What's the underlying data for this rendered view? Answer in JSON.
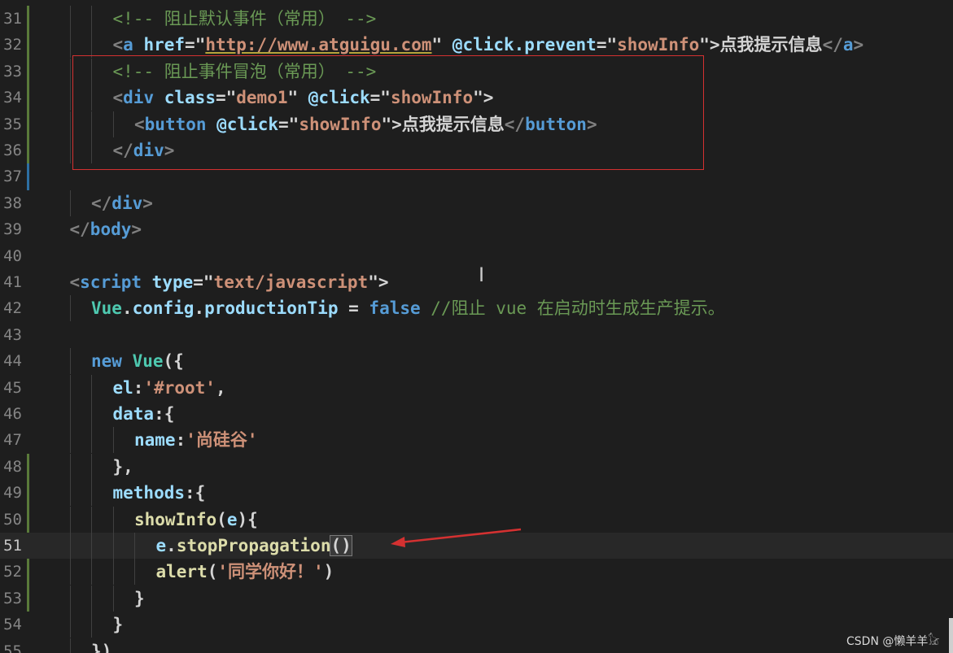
{
  "editor": {
    "lines": [
      {
        "n": "31",
        "indent": 3,
        "tokens": [
          {
            "t": "<!-- 阻止默认事件（常用） -->",
            "c": "cm"
          }
        ]
      },
      {
        "n": "32",
        "indent": 3,
        "tokens": [
          {
            "t": "<",
            "c": "br"
          },
          {
            "t": "a",
            "c": "tag"
          },
          {
            "t": " ",
            "c": "tx"
          },
          {
            "t": "href",
            "c": "at"
          },
          {
            "t": "=\"",
            "c": "tx"
          },
          {
            "t": "http://www.atguigu.com",
            "c": "st link"
          },
          {
            "t": "\"",
            "c": "tx"
          },
          {
            "t": " @click.prevent",
            "c": "at"
          },
          {
            "t": "=\"",
            "c": "tx"
          },
          {
            "t": "showInfo",
            "c": "st"
          },
          {
            "t": "\">",
            "c": "tx"
          },
          {
            "t": "点我提示信息",
            "c": "tx"
          },
          {
            "t": "</",
            "c": "br"
          },
          {
            "t": "a",
            "c": "tag"
          },
          {
            "t": ">",
            "c": "br"
          }
        ]
      },
      {
        "n": "33",
        "indent": 3,
        "tokens": [
          {
            "t": "<!-- 阻止事件冒泡（常用） -->",
            "c": "cm"
          }
        ]
      },
      {
        "n": "34",
        "indent": 3,
        "tokens": [
          {
            "t": "<",
            "c": "br"
          },
          {
            "t": "div",
            "c": "tag"
          },
          {
            "t": " ",
            "c": "tx"
          },
          {
            "t": "class",
            "c": "at"
          },
          {
            "t": "=\"",
            "c": "tx"
          },
          {
            "t": "demo1",
            "c": "st"
          },
          {
            "t": "\"",
            "c": "tx"
          },
          {
            "t": " @click",
            "c": "at"
          },
          {
            "t": "=\"",
            "c": "tx"
          },
          {
            "t": "showInfo",
            "c": "st"
          },
          {
            "t": "\">",
            "c": "tx"
          }
        ]
      },
      {
        "n": "35",
        "indent": 4,
        "tokens": [
          {
            "t": "<",
            "c": "br"
          },
          {
            "t": "button",
            "c": "tag"
          },
          {
            "t": " @click",
            "c": "at"
          },
          {
            "t": "=\"",
            "c": "tx"
          },
          {
            "t": "showInfo",
            "c": "st"
          },
          {
            "t": "\">",
            "c": "tx"
          },
          {
            "t": "点我提示信息",
            "c": "tx"
          },
          {
            "t": "</",
            "c": "br"
          },
          {
            "t": "button",
            "c": "tag"
          },
          {
            "t": ">",
            "c": "br"
          }
        ]
      },
      {
        "n": "36",
        "indent": 3,
        "tokens": [
          {
            "t": "</",
            "c": "br"
          },
          {
            "t": "div",
            "c": "tag"
          },
          {
            "t": ">",
            "c": "br"
          }
        ]
      },
      {
        "n": "37",
        "indent": 0,
        "tokens": []
      },
      {
        "n": "38",
        "indent": 2,
        "tokens": [
          {
            "t": "</",
            "c": "br"
          },
          {
            "t": "div",
            "c": "tag"
          },
          {
            "t": ">",
            "c": "br"
          }
        ]
      },
      {
        "n": "39",
        "indent": 1,
        "tokens": [
          {
            "t": "</",
            "c": "br"
          },
          {
            "t": "body",
            "c": "tag"
          },
          {
            "t": ">",
            "c": "br"
          }
        ]
      },
      {
        "n": "40",
        "indent": 0,
        "tokens": []
      },
      {
        "n": "41",
        "indent": 1,
        "tokens": [
          {
            "t": "<",
            "c": "br"
          },
          {
            "t": "script",
            "c": "tag"
          },
          {
            "t": " ",
            "c": "tx"
          },
          {
            "t": "type",
            "c": "at"
          },
          {
            "t": "=\"",
            "c": "tx"
          },
          {
            "t": "text/javascript",
            "c": "st"
          },
          {
            "t": "\">",
            "c": "tx"
          }
        ]
      },
      {
        "n": "42",
        "indent": 2,
        "tokens": [
          {
            "t": "Vue",
            "c": "cls"
          },
          {
            "t": ".",
            "c": "tx"
          },
          {
            "t": "config",
            "c": "pr"
          },
          {
            "t": ".",
            "c": "tx"
          },
          {
            "t": "productionTip",
            "c": "pr"
          },
          {
            "t": " = ",
            "c": "tx"
          },
          {
            "t": "false",
            "c": "kw"
          },
          {
            "t": " //阻止 vue 在启动时生成生产提示。",
            "c": "cm"
          }
        ]
      },
      {
        "n": "43",
        "indent": 0,
        "tokens": []
      },
      {
        "n": "44",
        "indent": 2,
        "tokens": [
          {
            "t": "new",
            "c": "kw"
          },
          {
            "t": " ",
            "c": "tx"
          },
          {
            "t": "Vue",
            "c": "cls"
          },
          {
            "t": "({",
            "c": "tx"
          }
        ]
      },
      {
        "n": "45",
        "indent": 3,
        "tokens": [
          {
            "t": "el",
            "c": "pr"
          },
          {
            "t": ":",
            "c": "tx"
          },
          {
            "t": "'#root'",
            "c": "st"
          },
          {
            "t": ",",
            "c": "tx"
          }
        ]
      },
      {
        "n": "46",
        "indent": 3,
        "tokens": [
          {
            "t": "data",
            "c": "pr"
          },
          {
            "t": ":{",
            "c": "tx"
          }
        ]
      },
      {
        "n": "47",
        "indent": 4,
        "tokens": [
          {
            "t": "name",
            "c": "pr"
          },
          {
            "t": ":",
            "c": "tx"
          },
          {
            "t": "'尚硅谷'",
            "c": "st"
          }
        ]
      },
      {
        "n": "48",
        "indent": 3,
        "tokens": [
          {
            "t": "},",
            "c": "tx"
          }
        ]
      },
      {
        "n": "49",
        "indent": 3,
        "tokens": [
          {
            "t": "methods",
            "c": "pr"
          },
          {
            "t": ":{",
            "c": "tx"
          }
        ]
      },
      {
        "n": "50",
        "indent": 4,
        "tokens": [
          {
            "t": "showInfo",
            "c": "fn"
          },
          {
            "t": "(",
            "c": "tx"
          },
          {
            "t": "e",
            "c": "pr"
          },
          {
            "t": "){",
            "c": "tx"
          }
        ]
      },
      {
        "n": "51",
        "indent": 5,
        "current": true,
        "tokens": [
          {
            "t": "e",
            "c": "pr"
          },
          {
            "t": ".",
            "c": "tx"
          },
          {
            "t": "stopPropagation",
            "c": "fn"
          },
          {
            "t": "()",
            "c": "tx bracket"
          }
        ]
      },
      {
        "n": "52",
        "indent": 5,
        "tokens": [
          {
            "t": "alert",
            "c": "fn"
          },
          {
            "t": "(",
            "c": "tx"
          },
          {
            "t": "'同学你好！'",
            "c": "st"
          },
          {
            "t": ")",
            "c": "tx"
          }
        ]
      },
      {
        "n": "53",
        "indent": 4,
        "tokens": [
          {
            "t": "}",
            "c": "tx"
          }
        ]
      },
      {
        "n": "54",
        "indent": 3,
        "tokens": [
          {
            "t": "}",
            "c": "tx"
          }
        ]
      },
      {
        "n": "55",
        "indent": 2,
        "tokens": [
          {
            "t": "})",
            "c": "tx"
          }
        ]
      }
    ]
  },
  "watermark": "CSDN @懒羊羊𓃠",
  "colors": {
    "background": "#1e1e1e",
    "annotation_box": "#d43131",
    "annotation_arrow": "#d43131"
  }
}
